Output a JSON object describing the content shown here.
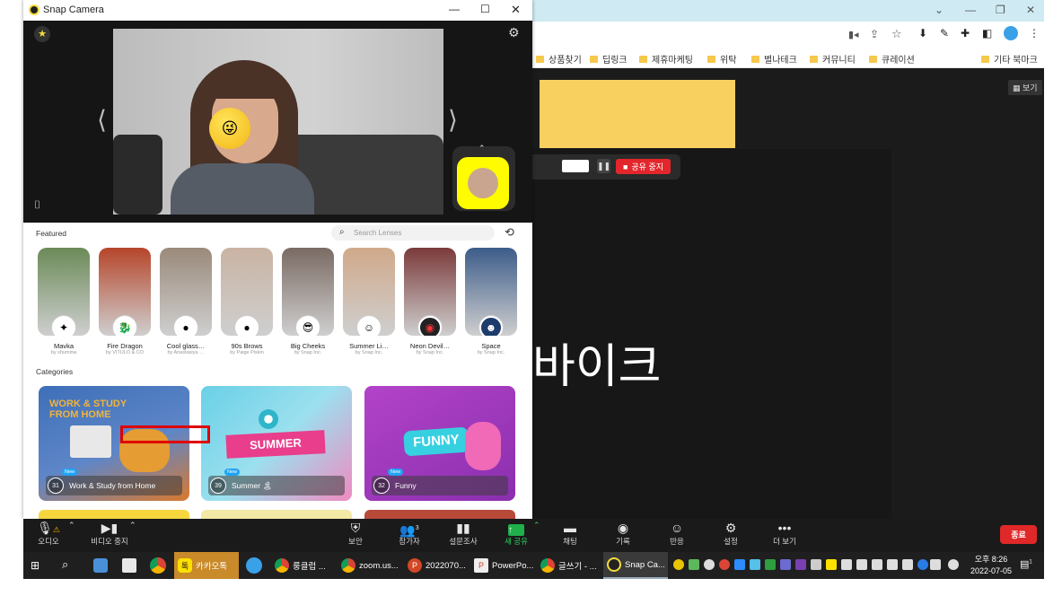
{
  "chrome": {
    "bookmarks": [
      "상품찾기",
      "딥링크",
      "제휴마케팅",
      "위탁",
      "별나테크",
      "커뮤니티",
      "큐레이션"
    ],
    "other_bookmarks": "기타 북마크",
    "view_label": "보기"
  },
  "zoom_share": {
    "stop_label": "공유 중지",
    "big_text": "바이크"
  },
  "snap": {
    "title": "Snap Camera",
    "featured_label": "Featured",
    "search_placeholder": "Search Lenses",
    "categories_label": "Categories",
    "lenses": [
      {
        "name": "Mavka",
        "by": "by shumma",
        "bg": "#6b8a58"
      },
      {
        "name": "Fire Dragon",
        "by": "by VITULO & CO",
        "bg": "#b6452a"
      },
      {
        "name": "Cool glass…",
        "by": "by Anastasiya …",
        "bg": "#9a8a7a"
      },
      {
        "name": "90s Brows",
        "by": "by Paige Piskin",
        "bg": "#c9b3a3"
      },
      {
        "name": "Big Cheeks",
        "by": "by Snap Inc.",
        "bg": "#7a6a63"
      },
      {
        "name": "Summer Li…",
        "by": "by Snap Inc.",
        "bg": "#d0a98a"
      },
      {
        "name": "Neon Devil…",
        "by": "by Snap Inc.",
        "bg": "#7b3a3a"
      },
      {
        "name": "Space",
        "by": "by Snap Inc.",
        "bg": "#3c5c8a"
      }
    ],
    "categories": [
      {
        "name": "Work & Study from Home",
        "count": "31",
        "banner": "WORK & STUDY FROM HOME",
        "new": "New"
      },
      {
        "name": "Summer 🏝",
        "count": "39",
        "banner": "SUMMER",
        "new": "New"
      },
      {
        "name": "Funny",
        "count": "32",
        "banner": "FUNNY",
        "new": "New"
      }
    ]
  },
  "zoom_toolbar": {
    "audio": "오디오",
    "video": "비디오 중지",
    "security": "보안",
    "participants": "참가자",
    "participants_count": "3",
    "polls": "설문조사",
    "new_share": "새 공유",
    "chat": "채팅",
    "record": "기록",
    "reactions": "반응",
    "settings": "설정",
    "more": "더 보기",
    "end": "종료"
  },
  "taskbar": {
    "apps": [
      "카카오톡",
      "룽클럽 ...",
      "zoom.us...",
      "2022070...",
      "PowerPo...",
      "글쓰기 - ...",
      "Snap Ca..."
    ],
    "time": "오후 8:26",
    "date": "2022-07-05",
    "notifications": "1"
  }
}
